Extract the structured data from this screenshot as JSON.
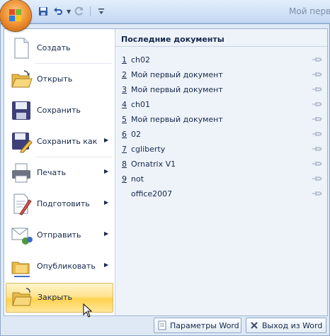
{
  "titlebar": {
    "title": "Мой первы"
  },
  "qat": {
    "save_icon": "save-icon",
    "undo_icon": "undo-icon",
    "redo_icon": "redo-icon"
  },
  "commands": [
    {
      "label": "Создать",
      "icon": "new-document-icon",
      "submenu": false
    },
    {
      "label": "Открыть",
      "icon": "open-folder-icon",
      "submenu": false
    },
    {
      "label": "Сохранить",
      "icon": "save-icon",
      "submenu": false
    },
    {
      "label": "Сохранить как",
      "icon": "save-as-icon",
      "submenu": true
    },
    {
      "label": "Печать",
      "icon": "printer-icon",
      "submenu": true
    },
    {
      "label": "Подготовить",
      "icon": "prepare-document-icon",
      "submenu": true
    },
    {
      "label": "Отправить",
      "icon": "send-icon",
      "submenu": true
    },
    {
      "label": "Опубликовать",
      "icon": "publish-icon",
      "submenu": true
    },
    {
      "label": "Закрыть",
      "icon": "close-folder-icon",
      "submenu": false,
      "hovered": true
    }
  ],
  "recent": {
    "title": "Последние документы",
    "items": [
      {
        "num": "1",
        "name": "ch02"
      },
      {
        "num": "2",
        "name": "Мой первый документ"
      },
      {
        "num": "3",
        "name": "Мой первый документ"
      },
      {
        "num": "4",
        "name": "ch01"
      },
      {
        "num": "5",
        "name": "Мой первый документ"
      },
      {
        "num": "6",
        "name": "02"
      },
      {
        "num": "7",
        "name": "cgliberty"
      },
      {
        "num": "8",
        "name": "Ornatrix V1"
      },
      {
        "num": "9",
        "name": "not"
      },
      {
        "num": "",
        "name": "office2007"
      }
    ]
  },
  "bottom": {
    "options_label": "Параметры Word",
    "exit_label": "Выход из Word"
  },
  "colors": {
    "hover_accent": "#ffd24f",
    "office_button": "#ee8c2c"
  }
}
